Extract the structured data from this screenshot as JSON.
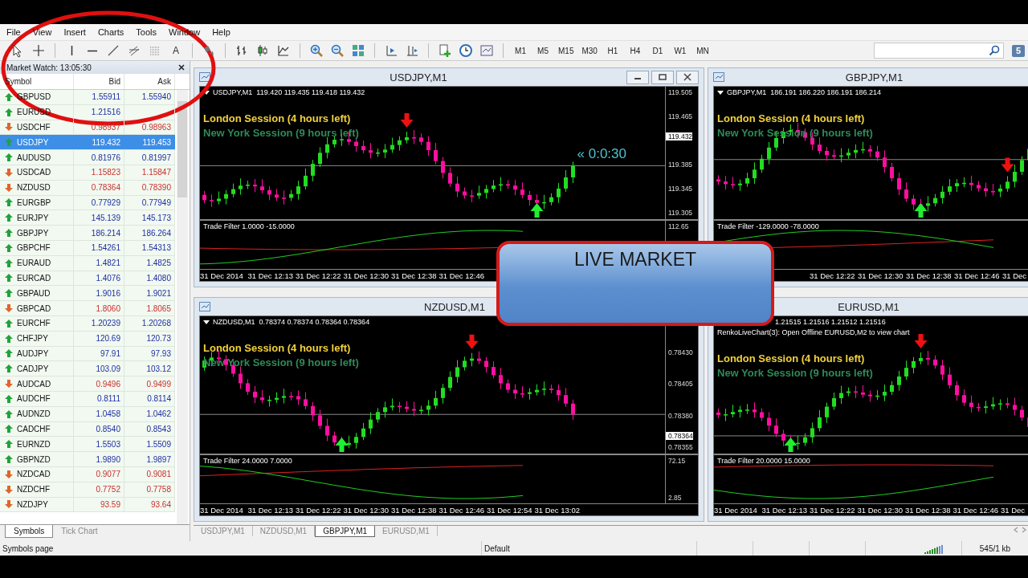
{
  "menu": [
    {
      "label": "File"
    },
    {
      "label": "View"
    },
    {
      "label": "Insert"
    },
    {
      "label": "Charts"
    },
    {
      "label": "Tools"
    },
    {
      "label": "Window"
    },
    {
      "label": "Help"
    }
  ],
  "toolbar": {
    "text_tool": "A",
    "timeframes": [
      "M1",
      "M5",
      "M15",
      "M30",
      "H1",
      "H4",
      "D1",
      "W1",
      "MN"
    ],
    "badge": "5"
  },
  "market_watch": {
    "title": "Market Watch: 13:05:30",
    "columns": [
      "Symbol",
      "Bid",
      "Ask"
    ],
    "rows": [
      {
        "symbol": "GBPUSD",
        "bid": "1.55911",
        "ask": "1.55940",
        "rising": true,
        "selected": false
      },
      {
        "symbol": "EURUSD",
        "bid": "1.21516",
        "rising": true,
        "selected": false
      },
      {
        "symbol": "USDCHF",
        "bid": "0.98937",
        "ask": "0.98963",
        "rising": false,
        "selected": false
      },
      {
        "symbol": "USDJPY",
        "bid": "119.432",
        "ask": "119.453",
        "rising": true,
        "selected": true
      },
      {
        "symbol": "AUDUSD",
        "bid": "0.81976",
        "ask": "0.81997",
        "rising": true,
        "selected": false
      },
      {
        "symbol": "USDCAD",
        "bid": "1.15823",
        "ask": "1.15847",
        "rising": false,
        "selected": false
      },
      {
        "symbol": "NZDUSD",
        "bid": "0.78364",
        "ask": "0.78390",
        "rising": false,
        "selected": false
      },
      {
        "symbol": "EURGBP",
        "bid": "0.77929",
        "ask": "0.77949",
        "rising": true,
        "selected": false
      },
      {
        "symbol": "EURJPY",
        "bid": "145.139",
        "ask": "145.173",
        "rising": true,
        "selected": false
      },
      {
        "symbol": "GBPJPY",
        "bid": "186.214",
        "ask": "186.264",
        "rising": true,
        "selected": false
      },
      {
        "symbol": "GBPCHF",
        "bid": "1.54261",
        "ask": "1.54313",
        "rising": true,
        "selected": false
      },
      {
        "symbol": "EURAUD",
        "bid": "1.4821",
        "ask": "1.4825",
        "rising": true,
        "selected": false
      },
      {
        "symbol": "EURCAD",
        "bid": "1.4076",
        "ask": "1.4080",
        "rising": true,
        "selected": false
      },
      {
        "symbol": "GBPAUD",
        "bid": "1.9016",
        "ask": "1.9021",
        "rising": true,
        "selected": false
      },
      {
        "symbol": "GBPCAD",
        "bid": "1.8060",
        "ask": "1.8065",
        "rising": false,
        "selected": false
      },
      {
        "symbol": "EURCHF",
        "bid": "1.20239",
        "ask": "1.20268",
        "rising": true,
        "selected": false
      },
      {
        "symbol": "CHFJPY",
        "bid": "120.69",
        "ask": "120.73",
        "rising": true,
        "selected": false
      },
      {
        "symbol": "AUDJPY",
        "bid": "97.91",
        "ask": "97.93",
        "rising": true,
        "selected": false
      },
      {
        "symbol": "CADJPY",
        "bid": "103.09",
        "ask": "103.12",
        "rising": true,
        "selected": false
      },
      {
        "symbol": "AUDCAD",
        "bid": "0.9496",
        "ask": "0.9499",
        "rising": false,
        "selected": false
      },
      {
        "symbol": "AUDCHF",
        "bid": "0.8111",
        "ask": "0.8114",
        "rising": true,
        "selected": false
      },
      {
        "symbol": "AUDNZD",
        "bid": "1.0458",
        "ask": "1.0462",
        "rising": true,
        "selected": false
      },
      {
        "symbol": "CADCHF",
        "bid": "0.8540",
        "ask": "0.8543",
        "rising": true,
        "selected": false
      },
      {
        "symbol": "EURNZD",
        "bid": "1.5503",
        "ask": "1.5509",
        "rising": true,
        "selected": false
      },
      {
        "symbol": "GBPNZD",
        "bid": "1.9890",
        "ask": "1.9897",
        "rising": true,
        "selected": false
      },
      {
        "symbol": "NZDCAD",
        "bid": "0.9077",
        "ask": "0.9081",
        "rising": false,
        "selected": false
      },
      {
        "symbol": "NZDCHF",
        "bid": "0.7752",
        "ask": "0.7758",
        "rising": false,
        "selected": false
      },
      {
        "symbol": "NZDJPY",
        "bid": "93.59",
        "ask": "93.64",
        "rising": false,
        "selected": false
      }
    ],
    "tabs": [
      {
        "label": "Symbols",
        "selected": true
      },
      {
        "label": "Tick Chart",
        "selected": false
      }
    ]
  },
  "charts": [
    {
      "title": "USDJPY,M1",
      "controls": true,
      "info": "USDJPY,M1  119.420 119.435 119.418 119.432",
      "sessions": [
        {
          "text": "London Session (4 hours left)",
          "kind": "london"
        },
        {
          "text": "New York Session (9 hours left)",
          "kind": "newyork"
        }
      ],
      "timer": "« 0:0:30",
      "price_labels": [
        {
          "text": "119.505",
          "current": false
        },
        {
          "text": "119.465",
          "current": false
        },
        {
          "text": "119.432",
          "current": true
        },
        {
          "text": "119.385",
          "current": false
        },
        {
          "text": "119.345",
          "current": false
        },
        {
          "text": "119.305",
          "current": false
        }
      ],
      "indicator": {
        "label": "Trade Filter 1.0000 -15.0000",
        "scale": [
          "112.65"
        ]
      },
      "time_labels": [
        "31 Dec 2014",
        "31 Dec 12:13",
        "31 Dec 12:22",
        "31 Dec 12:30",
        "31 Dec 12:38",
        "31 Dec 12:46"
      ]
    },
    {
      "title": "GBPJPY,M1",
      "info": "GBPJPY,M1  186.191 186.220 186.191 186.214",
      "sessions": [
        {
          "text": "London Session (4 hours left)",
          "kind": "london"
        },
        {
          "text": "New York Session (9 hours left)",
          "kind": "newyork"
        }
      ],
      "indicator": {
        "label": "Trade Filter -129.0000 -78.0000"
      },
      "time_labels": [
        "31 Dec 12:22",
        "31 Dec 12:30",
        "31 Dec 12:38",
        "31 Dec 12:46",
        "31 Dec"
      ]
    },
    {
      "title": "NZDUSD,M1",
      "info": "NZDUSD,M1  0.78374 0.78374 0.78364 0.78364",
      "sessions": [
        {
          "text": "London Session (4 hours left)",
          "kind": "london"
        },
        {
          "text": "New York Session (9 hours left)",
          "kind": "newyork"
        }
      ],
      "price_labels": [
        {
          "text": "0.78430",
          "current": false
        },
        {
          "text": "0.78405",
          "current": false
        },
        {
          "text": "0.78380",
          "current": false
        },
        {
          "text": "0.78364",
          "current": true
        },
        {
          "text": "0.78355",
          "current": false
        }
      ],
      "indicator": {
        "label": "Trade Filter 24.0000 7.0000",
        "scale": [
          "72.15",
          "2.85"
        ]
      },
      "time_labels": [
        "31 Dec 2014",
        "31 Dec 12:13",
        "31 Dec 12:22",
        "31 Dec 12:30",
        "31 Dec 12:38",
        "31 Dec 12:46",
        "31 Dec 12:54",
        "31 Dec 13:02"
      ]
    },
    {
      "title": "EURUSD,M1",
      "info": "1.21515 1.21516 1.21512 1.21516",
      "notice": "RenkoLiveChart(3): Open Offline EURUSD,M2 to view chart",
      "sessions": [
        {
          "text": "London Session (4 hours left)",
          "kind": "london"
        },
        {
          "text": "New York Session (9 hours left)",
          "kind": "newyork"
        }
      ],
      "indicator": {
        "label": "Trade Filter 20.0000 15.0000"
      },
      "time_labels": [
        "31 Dec 2014",
        "31 Dec 12:13",
        "31 Dec 12:22",
        "31 Dec 12:30",
        "31 Dec 12:38",
        "31 Dec 12:46",
        "31 Dec"
      ]
    }
  ],
  "chart_tabs": [
    {
      "label": "USDJPY,M1",
      "selected": false
    },
    {
      "label": "NZDUSD,M1",
      "selected": false
    },
    {
      "label": "GBPJPY,M1",
      "selected": true
    },
    {
      "label": "EURUSD,M1",
      "selected": false
    }
  ],
  "banner": {
    "text": "LIVE MARKET"
  },
  "status_bar": {
    "left": "Symbols page",
    "profile": "Default",
    "traffic": "545/1 kb"
  }
}
